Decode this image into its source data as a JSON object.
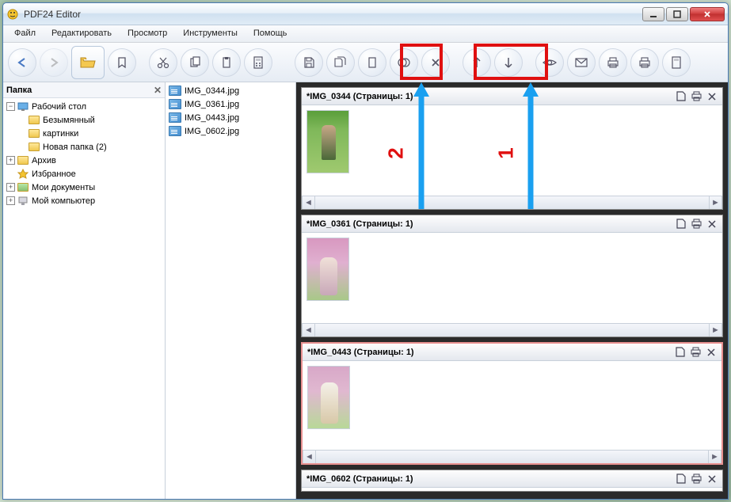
{
  "window": {
    "title": "PDF24 Editor"
  },
  "menu": [
    "Файл",
    "Редактировать",
    "Просмотр",
    "Инструменты",
    "Помощь"
  ],
  "folder_pane": {
    "header": "Папка"
  },
  "tree": {
    "root": "Рабочий стол",
    "items": [
      {
        "label": "Безымянный",
        "depth": 1,
        "icon": "folder"
      },
      {
        "label": "картинки",
        "depth": 1,
        "icon": "folder"
      },
      {
        "label": "Новая папка (2)",
        "depth": 1,
        "icon": "folder"
      },
      {
        "label": "Архив",
        "depth": 0,
        "icon": "folder",
        "exp": true
      },
      {
        "label": "Избранное",
        "depth": 0,
        "icon": "star",
        "exp": false
      },
      {
        "label": "Мои документы",
        "depth": 0,
        "icon": "docs",
        "exp": true
      },
      {
        "label": "Мой компьютер",
        "depth": 0,
        "icon": "computer",
        "exp": true
      }
    ]
  },
  "files": [
    "IMG_0344.jpg",
    "IMG_0361.jpg",
    "IMG_0443.jpg",
    "IMG_0602.jpg"
  ],
  "docs": [
    {
      "title": "*IMG_0344 (Страницы: 1)"
    },
    {
      "title": "*IMG_0361 (Страницы: 1)"
    },
    {
      "title": "*IMG_0443 (Страницы: 1)",
      "selected": true
    },
    {
      "title": "*IMG_0602 (Страницы: 1)"
    }
  ],
  "annotations": {
    "num1": "1",
    "num2": "2"
  }
}
